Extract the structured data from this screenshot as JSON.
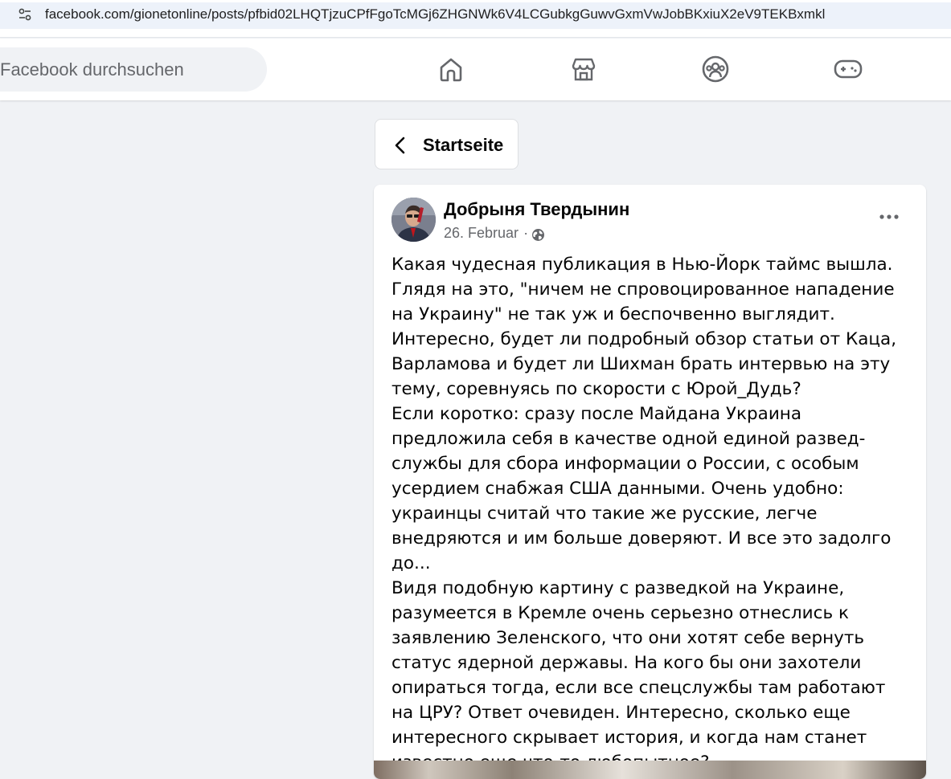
{
  "browser": {
    "url": "facebook.com/gionetonline/posts/pfbid02LHQTjzuCPfFgoTcMGj6ZHGNWk6V4LCGubkgGuwvGxmVwJobBKxiuX2eV9TEKBxmkl",
    "site_info_icon": "tune-icon"
  },
  "header": {
    "search_placeholder": "Facebook durchsuchen",
    "nav": [
      {
        "name": "home-icon"
      },
      {
        "name": "marketplace-icon"
      },
      {
        "name": "groups-icon"
      },
      {
        "name": "gaming-icon"
      }
    ]
  },
  "back": {
    "label": "Startseite",
    "icon": "chevron-left-icon"
  },
  "post": {
    "author": "Добрыня Твердынин",
    "date": "26. Februar",
    "separator": "·",
    "audience_icon": "globe-icon",
    "paragraphs": [
      "Какая чудесная публикация в Нью-Йорк таймс вышла. Глядя на это, \"ничем не спровоцированное нападение на Украину\" не так уж и беспочвенно выглядит. Интересно, будет ли подробный обзор статьи от Каца, Варламова и будет ли Шихман брать интервью на эту тему, соревнуясь по скорости с Юрой_Дудь?",
      "Если коротко: сразу после Майдана Украина предложила себя в качестве одной единой развед-службы для сбора информации о России, с особым усердием снабжая США данными. Очень удобно: украинцы считай что такие же русские, легче внедряются и им больше доверяют. И все это задолго до...",
      "Видя подобную картину с разведкой на Украине, разумеется в Кремле очень серьезно отнеслись к заявлению Зеленского, что они хотят себе вернуть статус ядерной державы. На кого бы они захотели опираться тогда, если все спецслужбы там работают на ЦРУ? Ответ очевиден. Интересно, сколько еще интересного скрывает история, и когда нам станет известно еще что-то любопытное?"
    ]
  },
  "colors": {
    "page_bg": "#f0f2f5",
    "card_bg": "#ffffff",
    "secondary_text": "#65676b",
    "icon": "#65676b"
  }
}
